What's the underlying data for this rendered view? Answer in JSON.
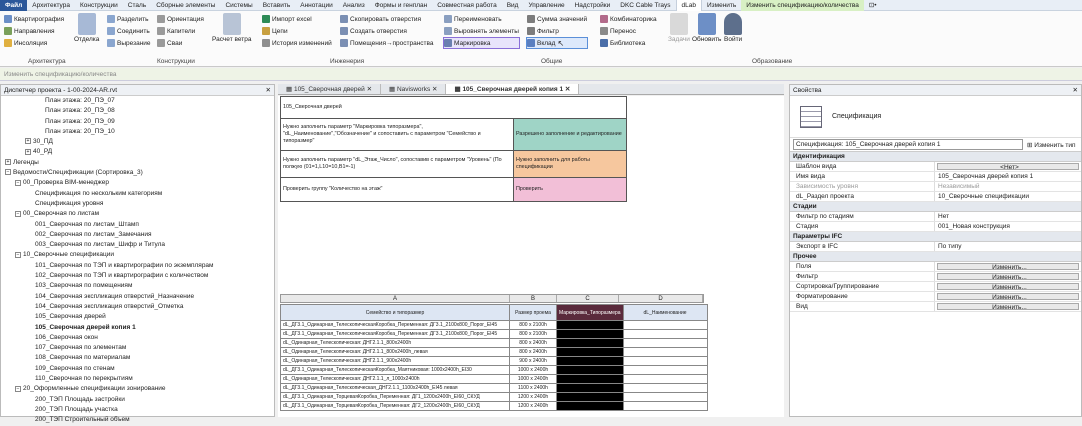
{
  "menu": [
    "Файл",
    "Архитектура",
    "Конструкции",
    "Сталь",
    "Сборные элементы",
    "Системы",
    "Вставить",
    "Аннотации",
    "Анализ",
    "Формы и генплан",
    "Совместная работа",
    "Вид",
    "Управление",
    "Надстройки",
    "DKC Cable Trays",
    "dLab",
    "Изменить",
    "Изменить спецификацию/количества"
  ],
  "ribbon": {
    "arch": {
      "b1": "Квартирография",
      "b2": "Направления",
      "b3": "Инсоляция",
      "big": "Отделка",
      "label": "Архитектура"
    },
    "constr": {
      "b1": "Разделить",
      "b2": "Соединить",
      "b3": "Вырезание",
      "c1": "Ориентация",
      "c2": "Капители",
      "c3": "Сваи",
      "big": "Расчет ветра",
      "label": "Конструкции"
    },
    "eng": {
      "b1": "Импорт excel",
      "b2": "Цепи",
      "b3": "История изменений",
      "c1": "Скопировать отверстия",
      "c2": "Создать отверстия",
      "c3": "Помещения→пространства",
      "label": "Инженерия"
    },
    "common": {
      "b1": "Переименовать",
      "b2": "Выровнять элементы",
      "b3": "Маркировка",
      "c1": "Сумма значений",
      "c2": "Фильтр",
      "c3": "Вклад",
      "d1": "Комбинаторика",
      "d2": "Перенос",
      "d3": "Библиотека",
      "label": "Общие"
    },
    "edu": {
      "b1": "Задачи",
      "b2": "Обновить",
      "b3": "Войти",
      "label": "Образование"
    }
  },
  "optionbar": "Изменить спецификацию/количества",
  "browser": {
    "title": "Диспетчер проекта - 1-00-2024-AR.rvt",
    "rows": [
      {
        "t": "План этажа: 20_ПЭ_07",
        "l": 4
      },
      {
        "t": "План этажа: 20_ПЭ_08",
        "l": 4
      },
      {
        "t": "План этажа: 20_ПЭ_09",
        "l": 4
      },
      {
        "t": "План этажа: 20_ПЭ_10",
        "l": 4
      },
      {
        "t": "30_ПД",
        "l": 2,
        "pm": "+"
      },
      {
        "t": "40_РД",
        "l": 2,
        "pm": "+"
      },
      {
        "t": "Легенды",
        "l": 0,
        "pm": "+"
      },
      {
        "t": "Ведомости/Спецификации (Сортировка_3)",
        "l": 0,
        "pm": "−"
      },
      {
        "t": "00_Проверка BIM-менеджер",
        "l": 1,
        "pm": "−"
      },
      {
        "t": "Спецификация по нескольким категориям",
        "l": 3
      },
      {
        "t": "Спецификация уровня",
        "l": 3
      },
      {
        "t": "00_Сверочная по листам",
        "l": 1,
        "pm": "−"
      },
      {
        "t": "001_Сверочная по листам_Штамп",
        "l": 3
      },
      {
        "t": "002_Сверочная по листам_Замечания",
        "l": 3
      },
      {
        "t": "003_Сверочная по листам_Шифр и Титула",
        "l": 3
      },
      {
        "t": "10_Сверочные спецификации",
        "l": 1,
        "pm": "−"
      },
      {
        "t": "101_Сверочная по ТЭП и квартирографии по экземплярам",
        "l": 3
      },
      {
        "t": "102_Сверочная по ТЭП и квартирографии с количеством",
        "l": 3
      },
      {
        "t": "103_Сверочная по помещениям",
        "l": 3
      },
      {
        "t": "104_Сверочная экспликация отверстий_Назначение",
        "l": 3
      },
      {
        "t": "104_Сверочная экспликация отверстий_Отметка",
        "l": 3
      },
      {
        "t": "105_Сверочная дверей",
        "l": 3
      },
      {
        "t": "105_Сверочная дверей копия 1",
        "l": 3,
        "sel": true
      },
      {
        "t": "106_Сверочная окон",
        "l": 3
      },
      {
        "t": "107_Сверочная по элементам",
        "l": 3
      },
      {
        "t": "108_Сверочная по материалам",
        "l": 3
      },
      {
        "t": "109_Сверочная по стенам",
        "l": 3
      },
      {
        "t": "110_Сверочная по перекрытиям",
        "l": 3
      },
      {
        "t": "20_Оформленные спецификации зонирование",
        "l": 1,
        "pm": "−"
      },
      {
        "t": "200_ТЭП Площадь застройки",
        "l": 3
      },
      {
        "t": "200_ТЭП Площадь участка",
        "l": 3
      },
      {
        "t": "200_ТЭП Строительный объем",
        "l": 3
      }
    ]
  },
  "tabs": [
    "105_Сверочная дверей",
    "Navisworks",
    "105_Сверочная дверей копия 1"
  ],
  "sheet": {
    "title": "105_Сверочная дверей",
    "r1a": "Нужно заполнить параметр \"Маркировка типоразмера\", \"dL_Наименование\",\"Обозначение\" и сопоставить с параметром \"Семейство и типоразмер\"",
    "r1b": "Разрешено заполнение и редактирование",
    "r2a": "Нужно заполнить параметр \"dL_Этаж_Число\", сопоставив с параметром \"Уровень\" (По полжую (01=1,L10=10,В1=-1)",
    "r2b": "Нужно заполнить для работы спецификации",
    "r3a": "Проверить группу \"Количество на этаж\"",
    "r3b": "Проверить",
    "cols": [
      "A",
      "B",
      "C",
      "D"
    ],
    "heads": [
      "Семейство и типоразмер",
      "Размер проема",
      "Маркировка_Типоразмера",
      "dL_Наименование"
    ],
    "rows": [
      [
        "dL_ДГ3.1_Одинарная_ТелескопическаяКоробка_Переменная: ДГ3.1_2100х800_Порог_EI45",
        "800 x 2100h"
      ],
      [
        "dL_ДГ3.1_Одинарная_ТелескопическаяКоробка_Переменная: ДГ3.1_2100х800_Порог_EI45",
        "800 x 2100h"
      ],
      [
        "dL_Одинарная_Телескопическая: ДНГ2.1.1_800x2400h",
        "800 x 2400h"
      ],
      [
        "dL_Одинарная_Телескопическая: ДНГ2.1.1_800x2400h_левая",
        "800 x 2400h"
      ],
      [
        "dL_Одинарная_Телескопическая: ДНГ2.1.1_900x2400h",
        "900 x 2400h"
      ],
      [
        "dL_ДГ3.1_Одинарная_ТелескопическаяКоробка_Маятниковая: 1000х2400h_EI30",
        "1000 x 2400h"
      ],
      [
        "dL_Одинарная_Телескопическая: ДНГ2.1.1_л_1000x2400h",
        "1000 x 2400h"
      ],
      [
        "dL_ДГ3.1_Одинарная_Телескопическая_ДНГ2.1.1_1100x2400h_EI45 левая",
        "1100 x 2400h"
      ],
      [
        "dL_ДГ3.1_Одинарная_ТорцеваяКоробка_Переменная: ДГ1_1200x2400h_EI60_СКУД",
        "1200 x 2400h"
      ],
      [
        "dL_ДГ3.1_Одинарная_ТорцеваяКоробка_Переменная: ДГ2_1200x2400h_EI60_СКУД",
        "1200 x 2400h"
      ]
    ]
  },
  "props": {
    "title": "Свойства",
    "type": "Спецификация",
    "selector": "Спецификация: 105_Сверочная дверей копия 1",
    "edit_type": "Изменить тип",
    "sections": [
      {
        "name": "Идентификация",
        "rows": [
          [
            "Шаблон вида",
            "<Нет>",
            "btn"
          ],
          [
            "Имя вида",
            "105_Сверочная дверей копия 1",
            ""
          ],
          [
            "Зависимость уровня",
            "Независимый",
            "g"
          ],
          [
            "dL_Раздел проекта",
            "10_Сверочные спецификации",
            ""
          ]
        ]
      },
      {
        "name": "Стадии",
        "rows": [
          [
            "Фильтр по стадиям",
            "Нет",
            ""
          ],
          [
            "Стадия",
            "001_Новая конструкция",
            ""
          ]
        ]
      },
      {
        "name": "Параметры IFC",
        "rows": [
          [
            "Экспорт в IFC",
            "По типу",
            ""
          ]
        ]
      },
      {
        "name": "Прочее",
        "rows": [
          [
            "Поля",
            "Изменить...",
            "btn"
          ],
          [
            "Фильтр",
            "Изменить...",
            "btn"
          ],
          [
            "Сортировка/Группирование",
            "Изменить...",
            "btn"
          ],
          [
            "Форматирование",
            "Изменить...",
            "btn"
          ],
          [
            "Вид",
            "Изменить...",
            "btn"
          ]
        ]
      }
    ]
  }
}
